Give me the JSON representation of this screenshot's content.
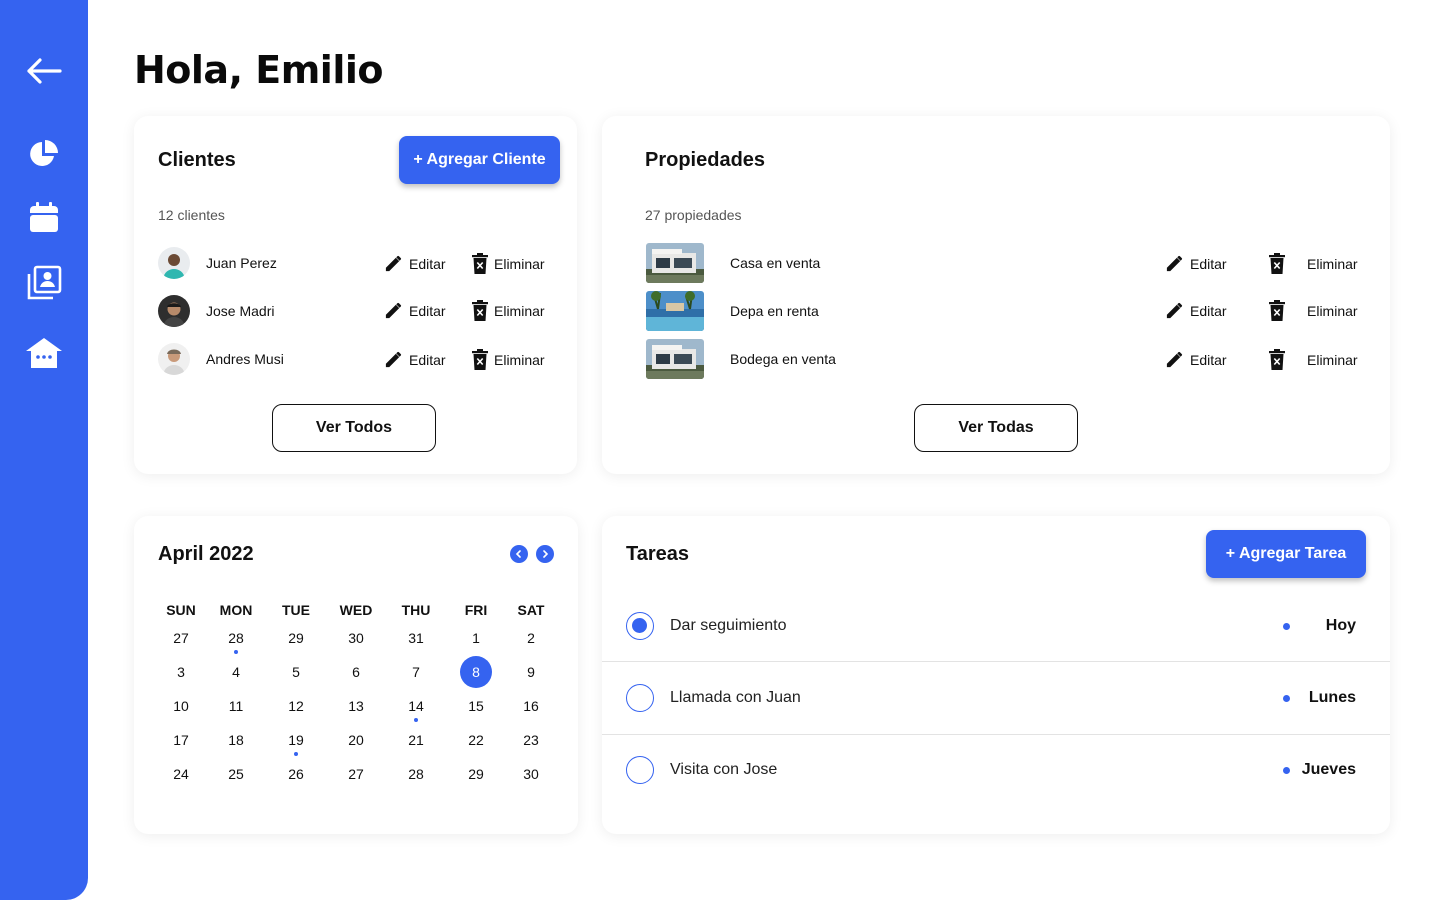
{
  "greeting": "Hola, Emilio",
  "sidebar": {
    "items": [
      {
        "icon": "back-arrow-icon"
      },
      {
        "icon": "pie-chart-icon"
      },
      {
        "icon": "calendar-icon"
      },
      {
        "icon": "contacts-icon"
      },
      {
        "icon": "home-icon"
      }
    ]
  },
  "clientes": {
    "title": "Clientes",
    "add_label": "+ Agregar Cliente",
    "count": "12 clientes",
    "edit_label": "Editar",
    "delete_label": "Eliminar",
    "items": [
      {
        "name": "Juan Perez"
      },
      {
        "name": "Jose Madri"
      },
      {
        "name": "Andres Musi"
      }
    ],
    "view_all": "Ver Todos"
  },
  "propiedades": {
    "title": "Propiedades",
    "count": "27 propiedades",
    "edit_label": "Editar",
    "delete_label": "Eliminar",
    "items": [
      {
        "name": "Casa en venta"
      },
      {
        "name": "Depa en renta"
      },
      {
        "name": "Bodega en venta"
      }
    ],
    "view_all": "Ver Todas"
  },
  "calendar": {
    "title": "April 2022",
    "weekdays": [
      "SUN",
      "MON",
      "TUE",
      "WED",
      "THU",
      "FRI",
      "SAT"
    ],
    "weeks": [
      [
        "27",
        "28",
        "29",
        "30",
        "31",
        "1",
        "2"
      ],
      [
        "3",
        "4",
        "5",
        "6",
        "7",
        "8",
        "9"
      ],
      [
        "10",
        "11",
        "12",
        "13",
        "14",
        "15",
        "16"
      ],
      [
        "17",
        "18",
        "19",
        "20",
        "21",
        "22",
        "23"
      ],
      [
        "24",
        "25",
        "26",
        "27",
        "28",
        "29",
        "30"
      ]
    ],
    "selected": "8",
    "event_days": [
      "28",
      "14",
      "19"
    ]
  },
  "tareas": {
    "title": "Tareas",
    "add_label": "+ Agregar Tarea",
    "items": [
      {
        "label": "Dar seguimiento",
        "when": "Hoy",
        "done": true
      },
      {
        "label": "Llamada con Juan",
        "when": "Lunes",
        "done": false
      },
      {
        "label": "Visita con Jose",
        "when": "Jueves",
        "done": false
      }
    ]
  },
  "colors": {
    "accent": "#3563f0"
  }
}
